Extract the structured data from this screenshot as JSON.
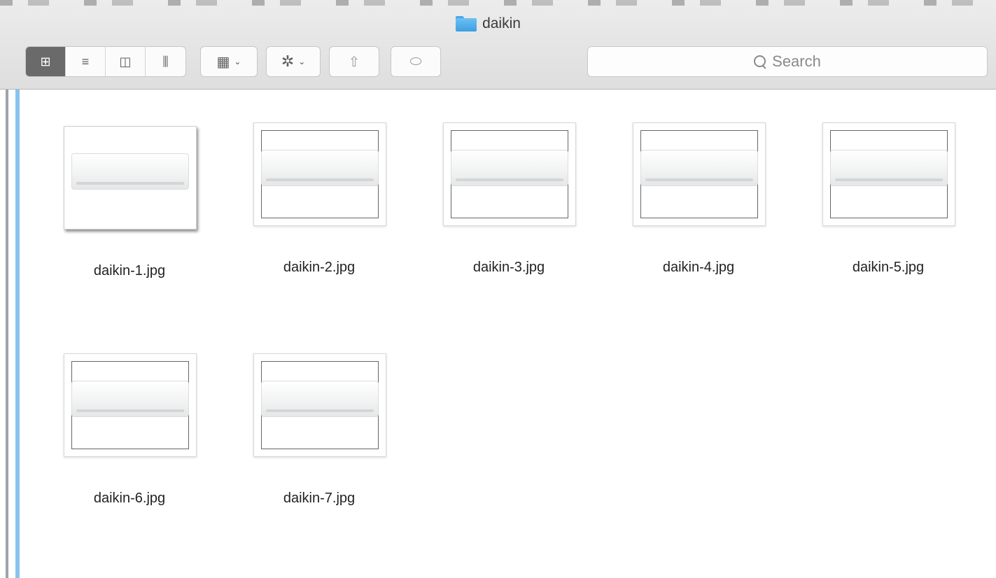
{
  "window": {
    "title": "daikin"
  },
  "toolbar": {
    "view_modes": [
      {
        "name": "view-icons-button",
        "icon": "icon-grid-icon",
        "glyph": "⊞",
        "active": true
      },
      {
        "name": "view-list-button",
        "icon": "list-icon",
        "glyph": "≡",
        "active": false
      },
      {
        "name": "view-columns-button",
        "icon": "columns-icon",
        "glyph": "◫",
        "active": false
      },
      {
        "name": "view-gallery-button",
        "icon": "gallery-icon",
        "glyph": "⫼",
        "active": false
      }
    ],
    "arrange_icon": "▦",
    "action_icon": "✲",
    "share_icon": "⇧",
    "tag_icon": "⬭",
    "chevron": "⌄"
  },
  "search": {
    "placeholder": "Search"
  },
  "files": [
    {
      "name": "daikin-1.jpg",
      "selected": true
    },
    {
      "name": "daikin-2.jpg",
      "selected": false
    },
    {
      "name": "daikin-3.jpg",
      "selected": false
    },
    {
      "name": "daikin-4.jpg",
      "selected": false
    },
    {
      "name": "daikin-5.jpg",
      "selected": false
    },
    {
      "name": "daikin-6.jpg",
      "selected": false
    },
    {
      "name": "daikin-7.jpg",
      "selected": false
    }
  ],
  "colors": {
    "folder": "#48a7e6",
    "active_view": "#6a6a6a",
    "scroll_accent": "#88c3f0"
  }
}
